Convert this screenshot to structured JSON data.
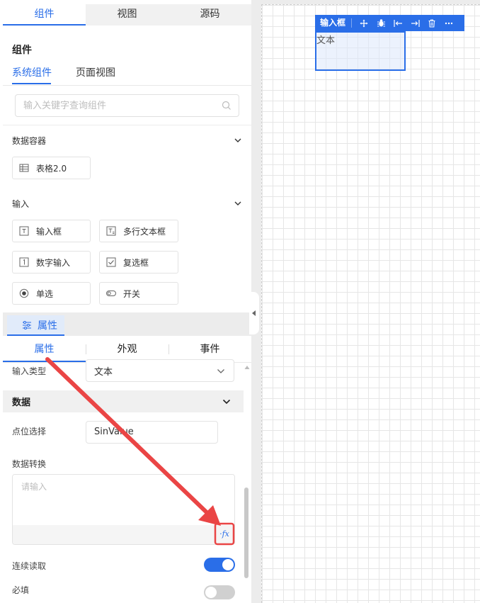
{
  "top_tabs": [
    "组件",
    "视图",
    "源码"
  ],
  "components": {
    "heading": "组件",
    "sub_tabs": [
      "系统组件",
      "页面视图"
    ],
    "search_placeholder": "输入关键字查询组件",
    "sections": {
      "data_container": {
        "title": "数据容器",
        "items": [
          "表格2.0"
        ]
      },
      "input": {
        "title": "输入",
        "items": [
          "输入框",
          "多行文本框",
          "数字输入",
          "复选框",
          "单选",
          "开关"
        ]
      }
    }
  },
  "properties": {
    "tag": "属性",
    "tabs": [
      "属性",
      "外观",
      "事件"
    ],
    "input_type_label": "输入类型",
    "input_type_value": "文本",
    "data_section": "数据",
    "point_label": "点位选择",
    "point_value": "SinValue",
    "transform_label": "数据转换",
    "transform_placeholder": "请输入",
    "fx_label": "·fx",
    "continuous_read_label": "连续读取",
    "continuous_read_on": true,
    "required_label": "必填",
    "required_on": false
  },
  "canvas": {
    "toolbar_title": "输入框",
    "widget_text": "文本"
  },
  "colors": {
    "accent": "#2a6ee8",
    "annotation": "#ea4545"
  }
}
